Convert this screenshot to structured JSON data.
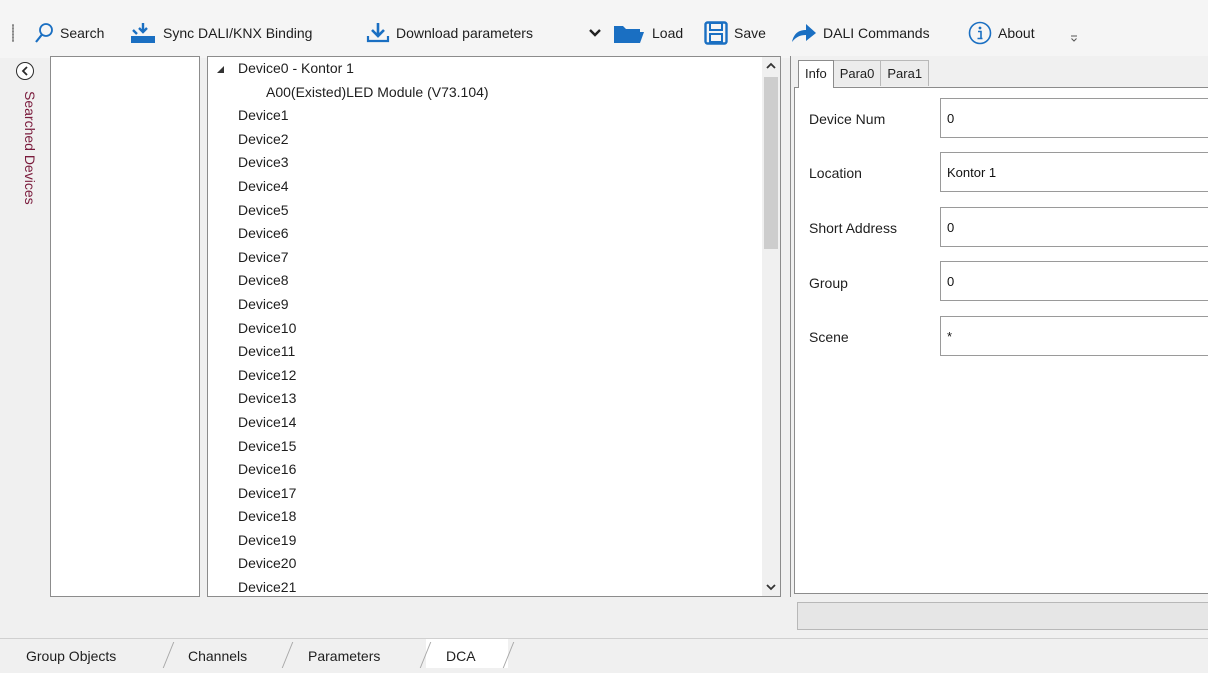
{
  "toolbar": {
    "search": "Search",
    "sync": "Sync DALI/KNX Binding",
    "download": "Download parameters",
    "load": "Load",
    "save": "Save",
    "dali_commands": "DALI Commands",
    "about": "About"
  },
  "side_panel": {
    "label": "Searched Devices"
  },
  "tree": {
    "root": "Device0 - Kontor 1",
    "child": "A00(Existed)LED Module (V73.104)",
    "devices": [
      "Device1",
      "Device2",
      "Device3",
      "Device4",
      "Device5",
      "Device6",
      "Device7",
      "Device8",
      "Device9",
      "Device10",
      "Device11",
      "Device12",
      "Device13",
      "Device14",
      "Device15",
      "Device16",
      "Device17",
      "Device18",
      "Device19",
      "Device20",
      "Device21"
    ]
  },
  "tabs": [
    "Info",
    "Para0",
    "Para1"
  ],
  "fields": {
    "device_num": {
      "label": "Device Num",
      "value": "0"
    },
    "location": {
      "label": "Location",
      "value": "Kontor 1"
    },
    "short_address": {
      "label": "Short Address",
      "value": "0"
    },
    "group": {
      "label": "Group",
      "value": "0"
    },
    "scene": {
      "label": "Scene",
      "value": "*"
    }
  },
  "bottom_tabs": [
    "Group Objects",
    "Channels",
    "Parameters",
    "DCA"
  ],
  "colors": {
    "accent": "#1a6fc2",
    "side_label": "#7a1b3c"
  },
  "icons": [
    "search-icon",
    "sync-icon",
    "download-icon",
    "dropdown-arrow-icon",
    "folder-icon",
    "save-icon",
    "arrow-right-icon",
    "info-icon",
    "chevron-left-icon"
  ]
}
